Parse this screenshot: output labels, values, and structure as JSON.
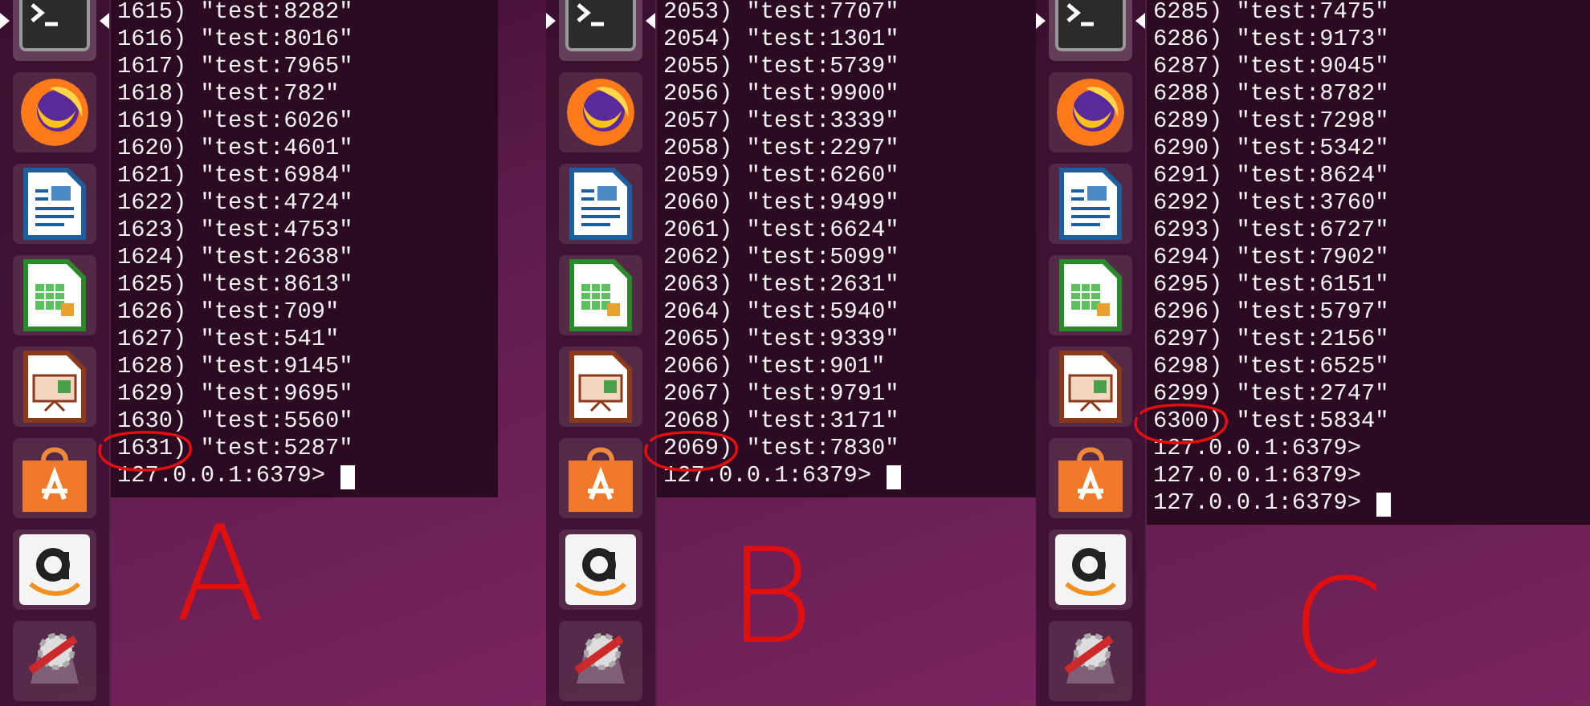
{
  "panels": [
    {
      "label": "A",
      "launcher": [
        {
          "kind": "terminal",
          "active": true
        },
        {
          "kind": "browser",
          "active": false
        },
        {
          "kind": "writer",
          "active": false
        },
        {
          "kind": "spreadsheet",
          "active": false
        },
        {
          "kind": "presentation",
          "active": false
        },
        {
          "kind": "store",
          "active": false
        },
        {
          "kind": "amazon",
          "active": false
        },
        {
          "kind": "settings",
          "active": false
        }
      ],
      "lines": [
        {
          "number": "1615)",
          "value": "\"test:8282\"",
          "circled": false
        },
        {
          "number": "1616)",
          "value": "\"test:8016\"",
          "circled": false
        },
        {
          "number": "1617)",
          "value": "\"test:7965\"",
          "circled": false
        },
        {
          "number": "1618)",
          "value": "\"test:782\"",
          "circled": false
        },
        {
          "number": "1619)",
          "value": "\"test:6026\"",
          "circled": false
        },
        {
          "number": "1620)",
          "value": "\"test:4601\"",
          "circled": false
        },
        {
          "number": "1621)",
          "value": "\"test:6984\"",
          "circled": false
        },
        {
          "number": "1622)",
          "value": "\"test:4724\"",
          "circled": false
        },
        {
          "number": "1623)",
          "value": "\"test:4753\"",
          "circled": false
        },
        {
          "number": "1624)",
          "value": "\"test:2638\"",
          "circled": false
        },
        {
          "number": "1625)",
          "value": "\"test:8613\"",
          "circled": false
        },
        {
          "number": "1626)",
          "value": "\"test:709\"",
          "circled": false
        },
        {
          "number": "1627)",
          "value": "\"test:541\"",
          "circled": false
        },
        {
          "number": "1628)",
          "value": "\"test:9145\"",
          "circled": false
        },
        {
          "number": "1629)",
          "value": "\"test:9695\"",
          "circled": false
        },
        {
          "number": "1630)",
          "value": "\"test:5560\"",
          "circled": false
        },
        {
          "number": "1631)",
          "value": "\"test:5287\"",
          "circled": true
        }
      ],
      "prompts": [
        "127.0.0.1:6379>"
      ],
      "cursor": true
    },
    {
      "label": "B",
      "launcher": [
        {
          "kind": "terminal",
          "active": true
        },
        {
          "kind": "browser",
          "active": false
        },
        {
          "kind": "writer",
          "active": false
        },
        {
          "kind": "spreadsheet",
          "active": false
        },
        {
          "kind": "presentation",
          "active": false
        },
        {
          "kind": "store",
          "active": false
        },
        {
          "kind": "amazon",
          "active": false
        },
        {
          "kind": "settings",
          "active": false
        }
      ],
      "lines": [
        {
          "number": "2053)",
          "value": "\"test:7707\"",
          "circled": false
        },
        {
          "number": "2054)",
          "value": "\"test:1301\"",
          "circled": false
        },
        {
          "number": "2055)",
          "value": "\"test:5739\"",
          "circled": false
        },
        {
          "number": "2056)",
          "value": "\"test:9900\"",
          "circled": false
        },
        {
          "number": "2057)",
          "value": "\"test:3339\"",
          "circled": false
        },
        {
          "number": "2058)",
          "value": "\"test:2297\"",
          "circled": false
        },
        {
          "number": "2059)",
          "value": "\"test:6260\"",
          "circled": false
        },
        {
          "number": "2060)",
          "value": "\"test:9499\"",
          "circled": false
        },
        {
          "number": "2061)",
          "value": "\"test:6624\"",
          "circled": false
        },
        {
          "number": "2062)",
          "value": "\"test:5099\"",
          "circled": false
        },
        {
          "number": "2063)",
          "value": "\"test:2631\"",
          "circled": false
        },
        {
          "number": "2064)",
          "value": "\"test:5940\"",
          "circled": false
        },
        {
          "number": "2065)",
          "value": "\"test:9339\"",
          "circled": false
        },
        {
          "number": "2066)",
          "value": "\"test:901\"",
          "circled": false
        },
        {
          "number": "2067)",
          "value": "\"test:9791\"",
          "circled": false
        },
        {
          "number": "2068)",
          "value": "\"test:3171\"",
          "circled": false
        },
        {
          "number": "2069)",
          "value": "\"test:7830\"",
          "circled": true
        }
      ],
      "prompts": [
        "127.0.0.1:6379>"
      ],
      "cursor": true
    },
    {
      "label": "C",
      "launcher": [
        {
          "kind": "terminal",
          "active": true
        },
        {
          "kind": "browser",
          "active": false
        },
        {
          "kind": "writer",
          "active": false
        },
        {
          "kind": "spreadsheet",
          "active": false
        },
        {
          "kind": "presentation",
          "active": false
        },
        {
          "kind": "store",
          "active": false
        },
        {
          "kind": "amazon",
          "active": false
        },
        {
          "kind": "settings",
          "active": false
        }
      ],
      "lines": [
        {
          "number": "6285)",
          "value": "\"test:7475\"",
          "circled": false
        },
        {
          "number": "6286)",
          "value": "\"test:9173\"",
          "circled": false
        },
        {
          "number": "6287)",
          "value": "\"test:9045\"",
          "circled": false
        },
        {
          "number": "6288)",
          "value": "\"test:8782\"",
          "circled": false
        },
        {
          "number": "6289)",
          "value": "\"test:7298\"",
          "circled": false
        },
        {
          "number": "6290)",
          "value": "\"test:5342\"",
          "circled": false
        },
        {
          "number": "6291)",
          "value": "\"test:8624\"",
          "circled": false
        },
        {
          "number": "6292)",
          "value": "\"test:3760\"",
          "circled": false
        },
        {
          "number": "6293)",
          "value": "\"test:6727\"",
          "circled": false
        },
        {
          "number": "6294)",
          "value": "\"test:7902\"",
          "circled": false
        },
        {
          "number": "6295)",
          "value": "\"test:6151\"",
          "circled": false
        },
        {
          "number": "6296)",
          "value": "\"test:5797\"",
          "circled": false
        },
        {
          "number": "6297)",
          "value": "\"test:2156\"",
          "circled": false
        },
        {
          "number": "6298)",
          "value": "\"test:6525\"",
          "circled": false
        },
        {
          "number": "6299)",
          "value": "\"test:2747\"",
          "circled": false
        },
        {
          "number": "6300)",
          "value": "\"test:5834\"",
          "circled": true
        }
      ],
      "prompts": [
        "127.0.0.1:6379>",
        "127.0.0.1:6379>",
        "127.0.0.1:6379>"
      ],
      "cursor": true
    }
  ]
}
